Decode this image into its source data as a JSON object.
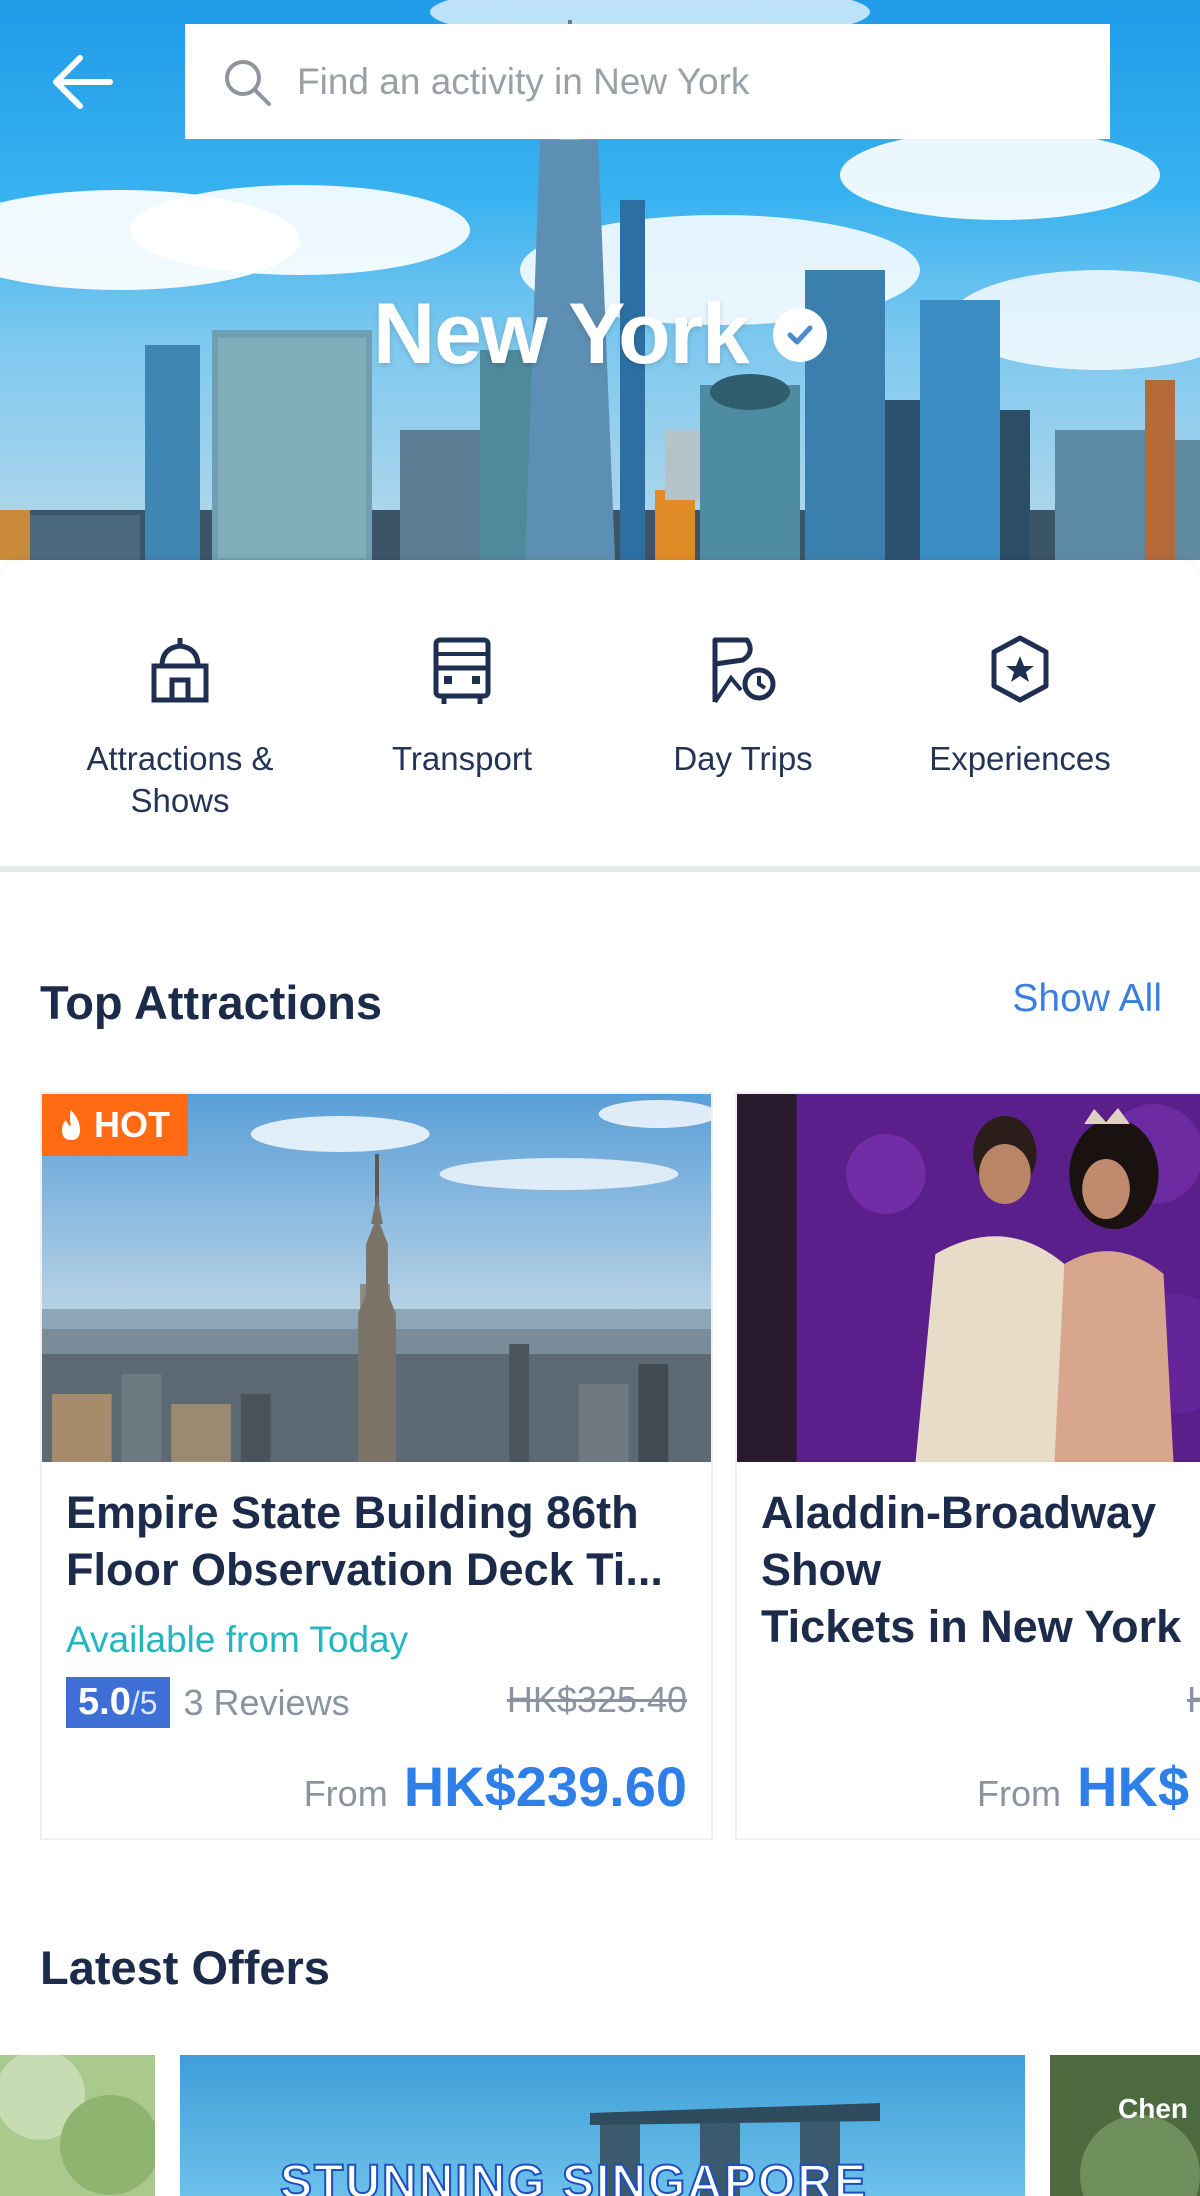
{
  "search": {
    "placeholder": "Find an activity in New York"
  },
  "hero": {
    "city": "New York"
  },
  "categories": [
    {
      "label": "Attractions &\nShows",
      "icon": "attraction-icon"
    },
    {
      "label": "Transport",
      "icon": "bus-icon"
    },
    {
      "label": "Day Trips",
      "icon": "day-trip-icon"
    },
    {
      "label": "Experiences",
      "icon": "experience-star-icon"
    }
  ],
  "top_attractions": {
    "title": "Top Attractions",
    "show_all": "Show All",
    "cards": [
      {
        "badge": "HOT",
        "title": "Empire State Building 86th\nFloor Observation Deck Ti...",
        "availability": "Available from Today",
        "rating": "5.0",
        "rating_max": "/5",
        "reviews": "3 Reviews",
        "old_price": "HK$325.40",
        "from_label": "From",
        "price": "HK$239.60"
      },
      {
        "title": "Aladdin-Broadway Show\nTickets in New York",
        "old_price": "HK",
        "from_label": "From",
        "price": "HK$"
      }
    ]
  },
  "latest_offers": {
    "title": "Latest Offers",
    "banners": [
      "STUNNING SINGAPORE",
      "Chen"
    ]
  },
  "colors": {
    "accent": "#2e7fe8",
    "hot": "#ff6a13",
    "availability": "#22b6c0",
    "rating_bg": "#3e6fd4"
  }
}
